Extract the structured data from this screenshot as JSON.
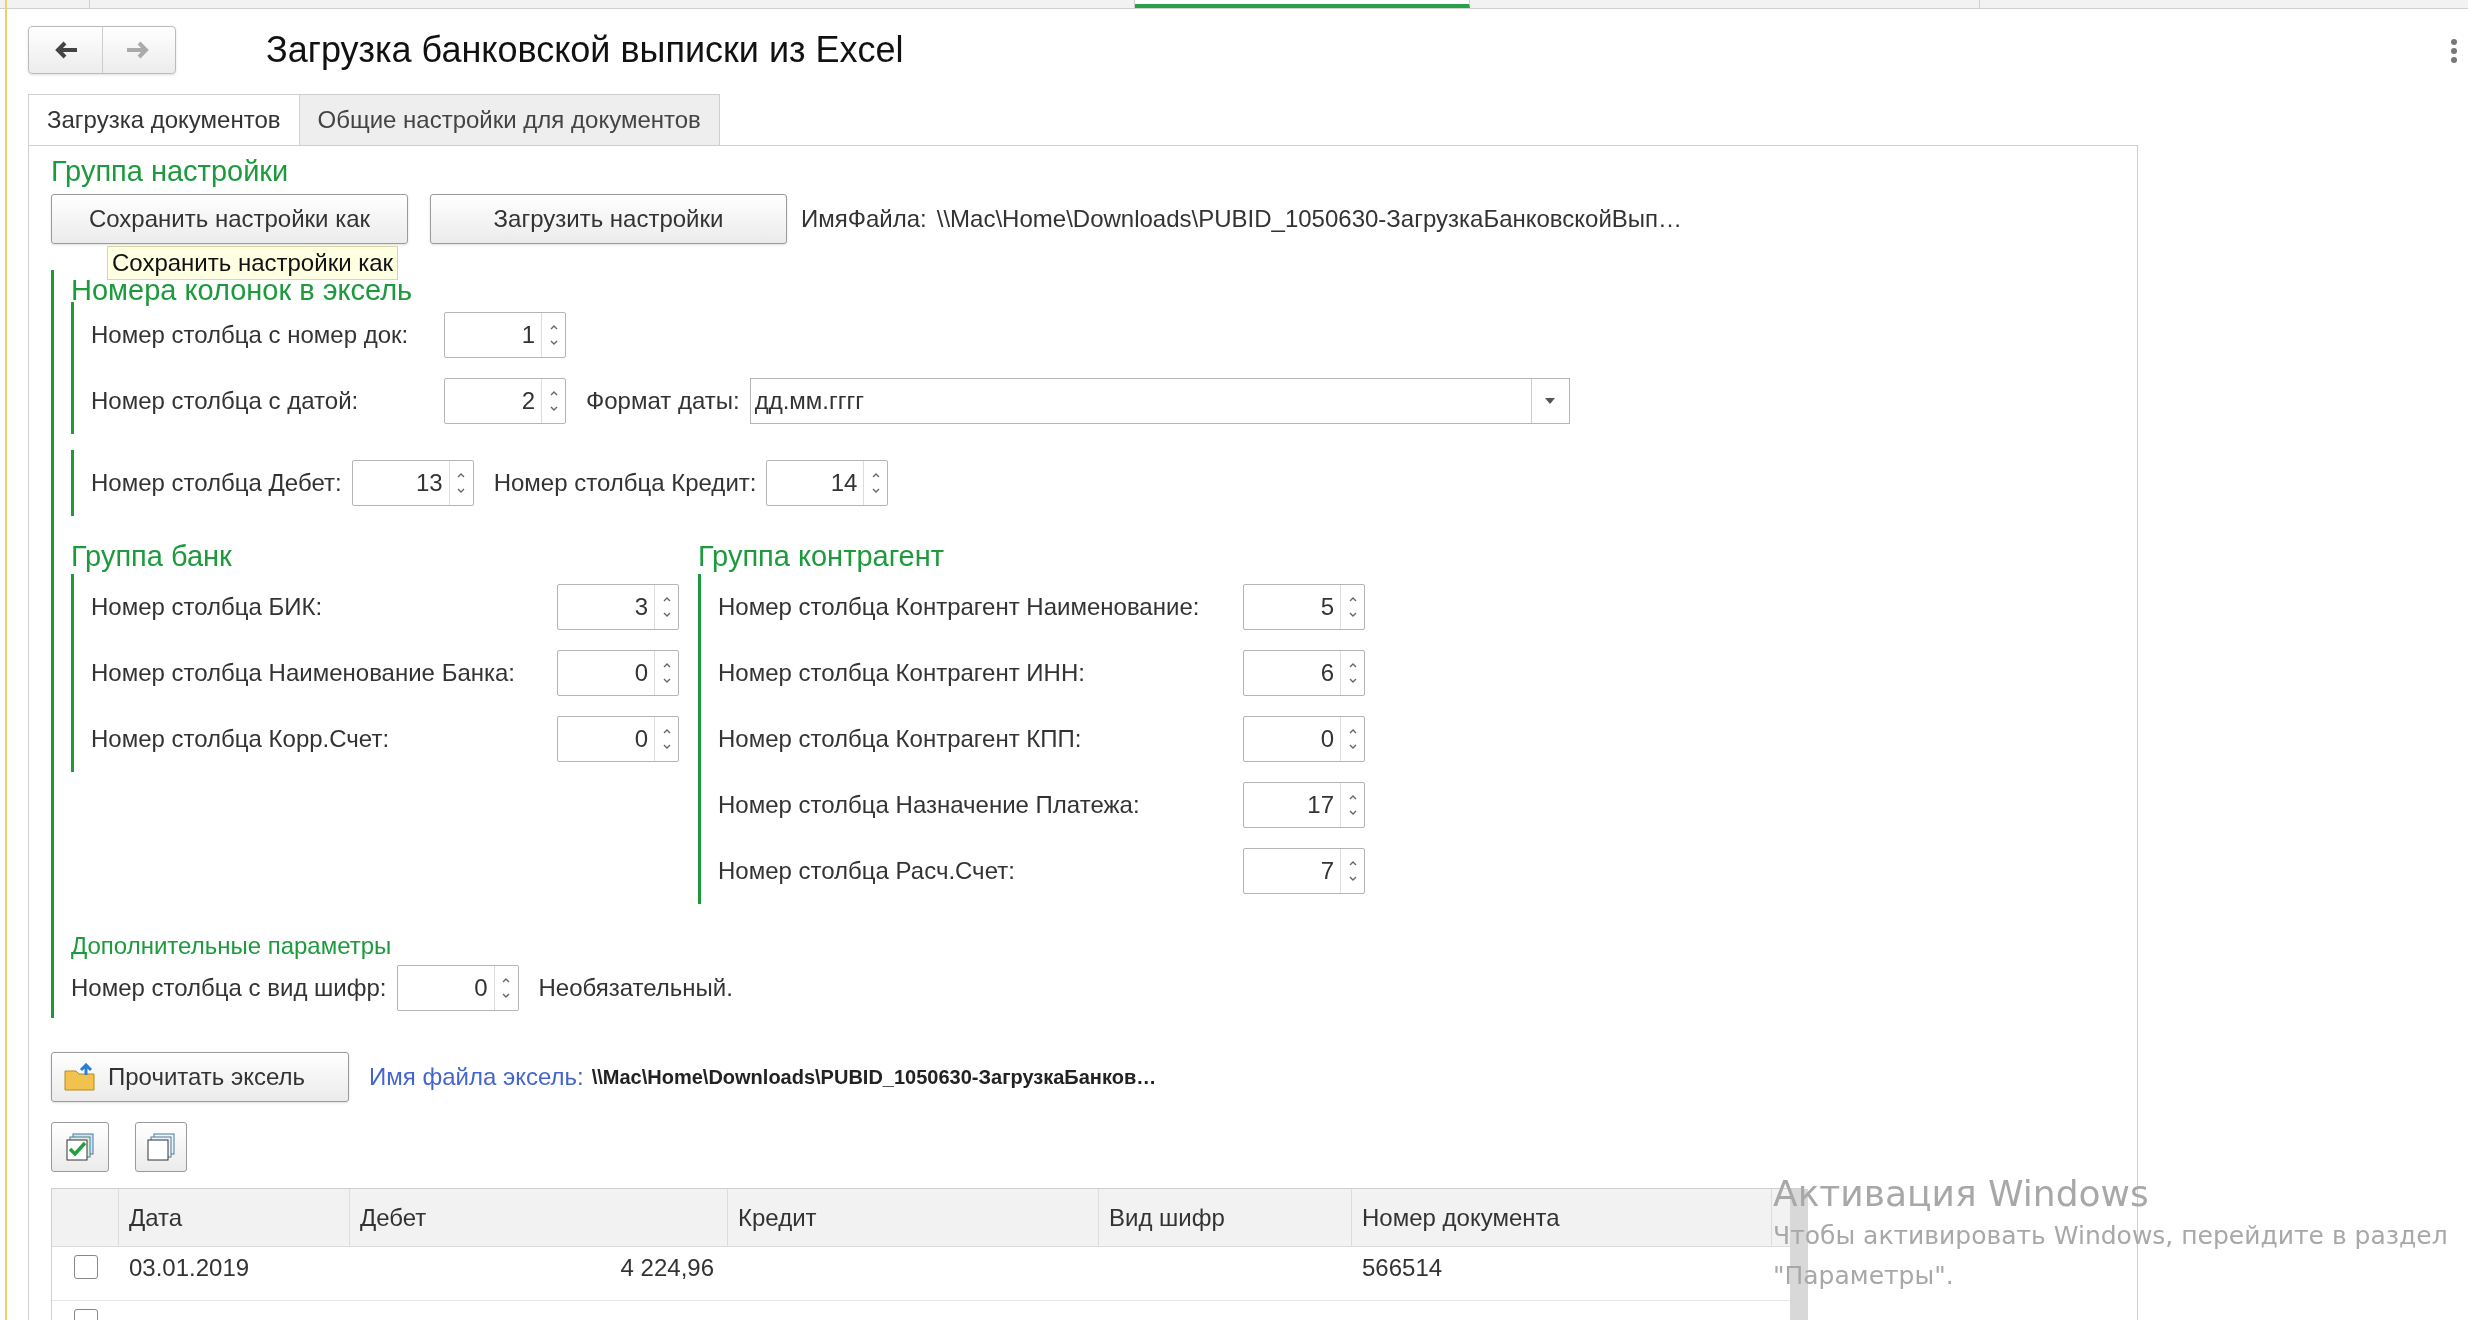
{
  "top_tabs": [
    {
      "selected": false
    },
    {
      "selected": false
    },
    {
      "selected": true
    },
    {
      "selected": false
    }
  ],
  "nav": [
    {
      "kind": "back",
      "disabled": false
    },
    {
      "kind": "forward",
      "disabled": true
    }
  ],
  "title": "Загрузка банковской выписки из Excel",
  "tabs": [
    {
      "label": "Загрузка документов",
      "selected": true
    },
    {
      "label": "Общие настройки для документов",
      "selected": false
    }
  ],
  "settings_group": {
    "title": "Группа настройки",
    "buttons": [
      "Сохранить настройки как",
      "Загрузить настройки"
    ],
    "file_label": "ИмяФайла:",
    "file_value": "\\\\Mac\\Home\\Downloads\\PUBID_1050630-ЗагрузкаБанковскойВып…"
  },
  "tooltip": "Сохранить настройки как",
  "columns_group": {
    "title": "Номера колонок в эксель",
    "rows": [
      [
        {
          "label": "Номер столбца с номер док:",
          "value": "1"
        }
      ],
      [
        {
          "label": "Номер столбца с датой:",
          "value": "2"
        },
        {
          "label": "Формат даты:",
          "combo": "дд.мм.гггг"
        }
      ],
      [
        {
          "label": "Номер столбца Дебет:",
          "value": "13"
        },
        {
          "label": "Номер столбца Кредит:",
          "value": "14"
        }
      ]
    ]
  },
  "bank_group": {
    "title": "Группа банк",
    "rows": [
      {
        "label": "Номер столбца БИК:",
        "value": "3"
      },
      {
        "label": "Номер столбца Наименование Банка:",
        "value": "0"
      },
      {
        "label": "Номер столбца Корр.Счет:",
        "value": "0"
      }
    ]
  },
  "contractor_group": {
    "title": "Группа контрагент",
    "rows": [
      {
        "label": "Номер столбца Контрагент Наименование:",
        "value": "5"
      },
      {
        "label": "Номер столбца Контрагент ИНН:",
        "value": "6"
      },
      {
        "label": "Номер столбца Контрагент КПП:",
        "value": "0"
      },
      {
        "label": "Номер столбца Назначение Платежа:",
        "value": "17"
      },
      {
        "label": "Номер столбца Расч.Счет:",
        "value": "7"
      }
    ]
  },
  "extra_group": {
    "title": "Дополнительные параметры",
    "label": "Номер столбца с вид шифр:",
    "value": "0",
    "note": "Необязательный."
  },
  "read_button": "Прочитать эксель",
  "excel_file_label": "Имя файла эксель:",
  "excel_file_value": "\\\\Mac\\Home\\Downloads\\PUBID_1050630-ЗагрузкаБанков…",
  "table": {
    "columns": [
      "Дата",
      "Дебет",
      "Кредит",
      "Вид шифр",
      "Номер документа"
    ],
    "rows": [
      {
        "checked": false,
        "cells": [
          "03.01.2019",
          "4 224,96",
          "",
          "",
          "566514"
        ]
      },
      {
        "checked": false,
        "cells": []
      }
    ]
  },
  "windows_activation": {
    "title": "Активация Windows",
    "lines": [
      "Чтобы активировать Windows, перейдите в раздел",
      "\"Параметры\"."
    ]
  }
}
